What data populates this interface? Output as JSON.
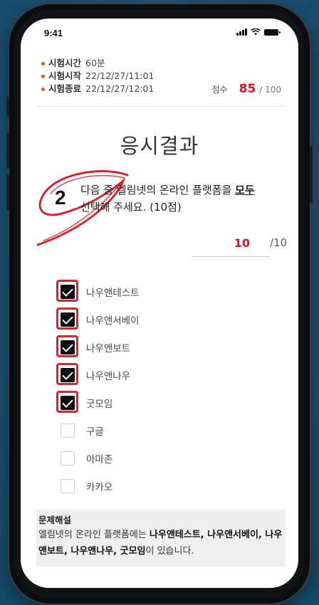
{
  "status_bar": {
    "time": "9:41"
  },
  "exam_info": {
    "duration_label": "시험시간",
    "duration": "60분",
    "start_label": "시험시작",
    "start": "22/12/27/11:01",
    "end_label": "시험종료",
    "end": "22/12/27/12:01"
  },
  "score": {
    "label": "점수",
    "value": "85",
    "total": "/ 100"
  },
  "page_title": "응시결과",
  "question": {
    "number": "2",
    "text_part1": "다음 중 엘림넷의 온라인 플랫폼을 ",
    "text_emphasis": "모두",
    "text_part2": "선택해 주세요. (10점)",
    "points_earned": "10",
    "points_total": "/10"
  },
  "options": [
    {
      "label": "나우앤테스트",
      "checked": true,
      "marked": true
    },
    {
      "label": "나우앤서베이",
      "checked": true,
      "marked": true
    },
    {
      "label": "나우앤보트",
      "checked": true,
      "marked": true
    },
    {
      "label": "나우앤나우",
      "checked": true,
      "marked": true
    },
    {
      "label": "굿모임",
      "checked": true,
      "marked": true
    },
    {
      "label": "구글",
      "checked": false,
      "marked": false
    },
    {
      "label": "아마존",
      "checked": false,
      "marked": false
    },
    {
      "label": "카카오",
      "checked": false,
      "marked": false
    }
  ],
  "explanation": {
    "title": "문제해설",
    "prefix": "엘림넷의 온라인 플랫폼에는 ",
    "answers": "나우앤테스트, 나우앤서베이, 나우앤보트, 나우앤나우, 굿모임",
    "suffix": "이 있습니다."
  },
  "colors": {
    "accent_red": "#e00f1e",
    "bullet_orange": "#e06010",
    "background": "#1f5a7e"
  },
  "icons": [
    "signal-icon",
    "wifi-icon",
    "battery-icon",
    "checkbox-checked-icon",
    "correct-mark-icon"
  ]
}
